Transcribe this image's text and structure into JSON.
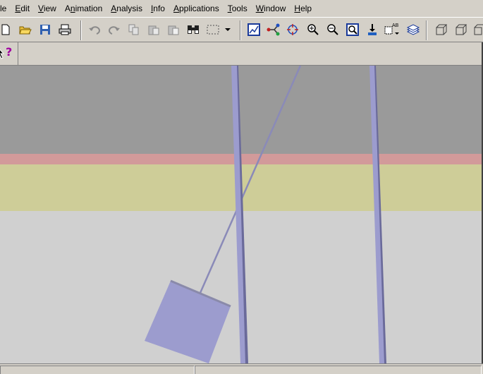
{
  "menubar": {
    "items": [
      {
        "label": "le",
        "key": ""
      },
      {
        "label": "Edit",
        "key": "E"
      },
      {
        "label": "View",
        "key": "V"
      },
      {
        "label": "Animation",
        "key": "n"
      },
      {
        "label": "Analysis",
        "key": "A"
      },
      {
        "label": "Info",
        "key": "I"
      },
      {
        "label": "Applications",
        "key": "A"
      },
      {
        "label": "Tools",
        "key": "T"
      },
      {
        "label": "Window",
        "key": "W"
      },
      {
        "label": "Help",
        "key": "H"
      }
    ]
  },
  "toolbar": {
    "icons": [
      "new-file-icon",
      "open-folder-icon",
      "save-icon",
      "print-icon",
      "undo-icon",
      "redo-icon",
      "copy-icon",
      "paste-icon",
      "paste-special-icon",
      "find-icon",
      "select-region-icon",
      "dropdown-arrow-icon",
      "graph-icon",
      "branch-icon",
      "transform-icon",
      "zoom-in-icon",
      "zoom-out-icon",
      "zoom-fit-icon",
      "move-down-icon",
      "label-ab-icon",
      "layers-icon",
      "cube-front-icon",
      "cube-iso-icon",
      "cube-side-icon"
    ],
    "label_ab": "AB"
  },
  "toolbar2": {
    "help_glyph": "?"
  },
  "colors": {
    "background": "#d4d0c8",
    "viewport_floor": "#d0d0d0",
    "band_gray": "#9a9a9a",
    "band_pink": "#d29a9a",
    "band_yellow": "#cecd98",
    "pendulum": "#9c9cce",
    "rope": "#8a8ab8"
  }
}
